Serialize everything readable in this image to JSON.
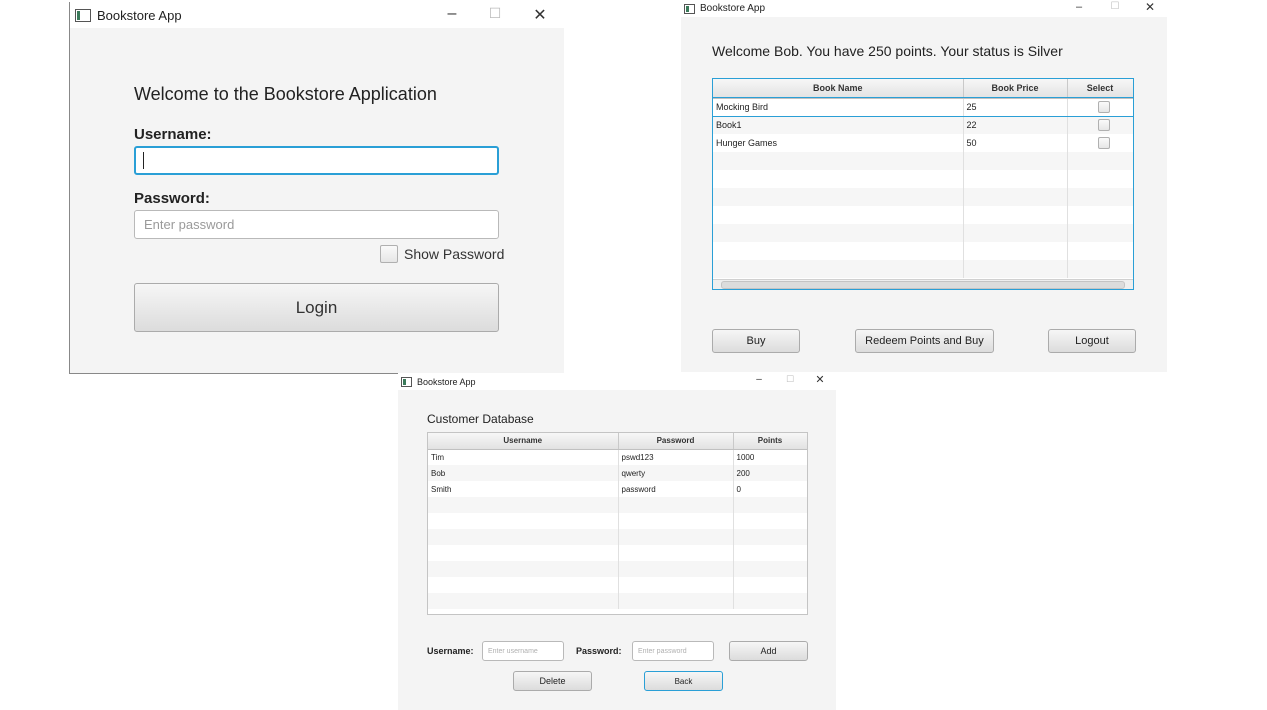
{
  "login_window": {
    "title": "Bookstore App",
    "heading": "Welcome to the Bookstore Application",
    "username_label": "Username:",
    "username_value": "",
    "password_label": "Password:",
    "password_placeholder": "Enter password",
    "show_password_label": "Show Password",
    "login_label": "Login",
    "controls": {
      "minimize": "–",
      "maximize": "☐",
      "close": "✕"
    }
  },
  "books_window": {
    "title": "Bookstore App",
    "welcome": "Welcome Bob. You have 250 points. Your status is Silver",
    "columns": [
      "Book Name",
      "Book Price",
      "Select"
    ],
    "rows": [
      {
        "name": "Mocking Bird",
        "price": "25",
        "selected": false
      },
      {
        "name": "Book1",
        "price": "22",
        "selected": false
      },
      {
        "name": "Hunger Games",
        "price": "50",
        "selected": false
      }
    ],
    "buy_label": "Buy",
    "redeem_label": "Redeem Points and Buy",
    "logout_label": "Logout",
    "controls": {
      "minimize": "–",
      "maximize": "☐",
      "close": "✕"
    }
  },
  "customer_window": {
    "title": "Bookstore App",
    "heading": "Customer Database",
    "columns": [
      "Username",
      "Password",
      "Points"
    ],
    "rows": [
      {
        "username": "Tim",
        "password": "pswd123",
        "points": "1000"
      },
      {
        "username": "Bob",
        "password": "qwerty",
        "points": "200"
      },
      {
        "username": "Smith",
        "password": "password",
        "points": "0"
      }
    ],
    "username_label": "Username:",
    "username_placeholder": "Enter username",
    "password_label": "Password:",
    "password_placeholder": "Enter password",
    "add_label": "Add",
    "delete_label": "Delete",
    "back_label": "Back",
    "controls": {
      "minimize": "–",
      "maximize": "☐",
      "close": "✕"
    }
  },
  "colors": {
    "focus_border": "#2a9fd6",
    "window_bg": "#f4f4f4",
    "table_header_bg": "#e6e6e6"
  }
}
